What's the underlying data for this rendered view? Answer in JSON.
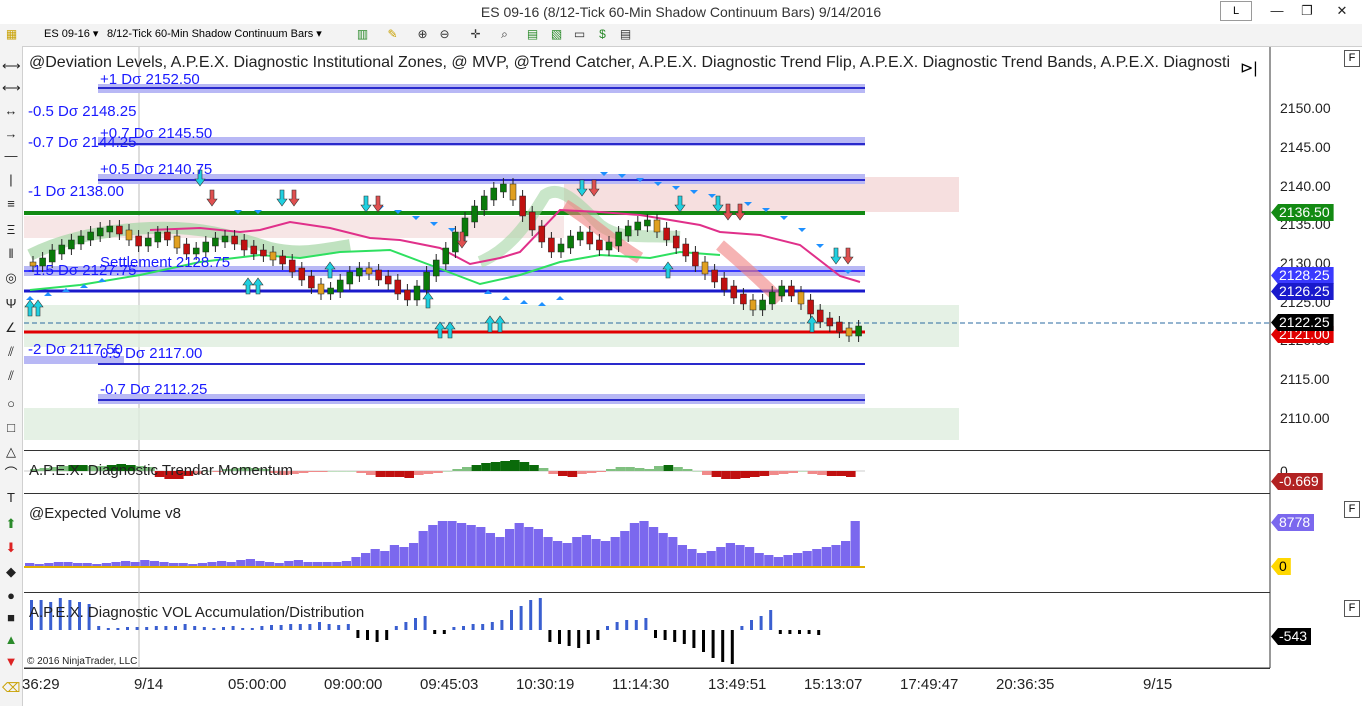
{
  "window": {
    "title": "ES 09-16 (8/12-Tick 60-Min Shadow Continuum Bars)  9/14/2016",
    "l_button": "L",
    "minimize": "—",
    "maximize": "❐",
    "close": "✕"
  },
  "toolbar": {
    "instrument": "ES 09-16",
    "bar_type": "8/12-Tick 60-Min Shadow Continuum Bars"
  },
  "main_panel": {
    "indicators_label": "@Deviation Levels, A.P.E.X. Diagnostic Institutional Zones, @ MVP, @Trend Catcher, A.P.E.X. Diagnostic Trend Flip, A.P.E.X. Diagnostic Trend Bands, A.P.E.X. Diagnosti",
    "y_ticks": [
      "2150.00",
      "2145.00",
      "2140.00",
      "2135.00",
      "2130.00",
      "2125.00",
      "2120.00",
      "2115.00",
      "2110.00"
    ],
    "price_tags": [
      {
        "value": "2136.50",
        "color": "#138a13"
      },
      {
        "value": "2128.25",
        "color": "#3a3aff"
      },
      {
        "value": "2126.25",
        "color": "#1a1acc"
      },
      {
        "value": "2122.25",
        "color": "#000000"
      },
      {
        "value": "2121.00",
        "color": "#e00000"
      }
    ],
    "deviation_labels": [
      "+1 Dσ 2152.50",
      "-0.5 Dσ 2148.25",
      "+0.7 Dσ 2145.50",
      "-0.7 Dσ 2144.25",
      "+0.5 Dσ 2140.75",
      "-1 Dσ 2138.00",
      "-1.5 Dσ 2127.75",
      "Settlement 2128.75",
      "-2 Dσ 2117.50",
      "0.5 Dσ 2117.00",
      "-0.7 Dσ 2112.25"
    ]
  },
  "momentum_panel": {
    "label": "A.P.E.X. Diagnostic Trendar Momentum",
    "zero_label": "0",
    "value": "-0.669",
    "value_color": "#b22222"
  },
  "volume_panel": {
    "label": "@Expected Volume v8",
    "value": "8778",
    "value_color": "#7b68ee",
    "zero_value": "0",
    "zero_color": "#ffd700"
  },
  "vol_panel": {
    "label": "A.P.E.X. Diagnostic VOL Accumulation/Distribution",
    "value": "-543",
    "value_color": "#000000"
  },
  "x_axis": {
    "labels": [
      "36:29",
      "9/14",
      "05:00:00",
      "09:00:00",
      "09:45:03",
      "10:30:19",
      "11:14:30",
      "13:49:51",
      "15:13:07",
      "17:49:47",
      "20:36:35",
      "9/15"
    ]
  },
  "copyright": "© 2016 NinjaTrader, LLC",
  "panel_button": "F"
}
